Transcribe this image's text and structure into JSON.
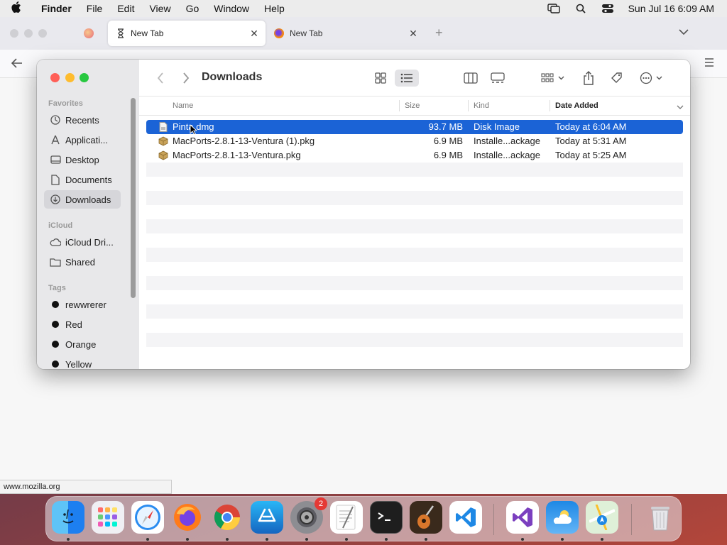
{
  "menubar": {
    "app": "Finder",
    "items": [
      "File",
      "Edit",
      "View",
      "Go",
      "Window",
      "Help"
    ],
    "datetime": "Sun Jul 16  6:09 AM"
  },
  "browser": {
    "tabs": [
      {
        "label": "New Tab",
        "active": true
      },
      {
        "label": "New Tab",
        "active": false
      }
    ],
    "status_url": "www.mozilla.org"
  },
  "finder": {
    "title": "Downloads",
    "sidebar": {
      "favorites_header": "Favorites",
      "favorites": [
        {
          "label": "Recents",
          "icon": "clock-icon"
        },
        {
          "label": "Applicati...",
          "icon": "applications-icon"
        },
        {
          "label": "Desktop",
          "icon": "desktop-icon"
        },
        {
          "label": "Documents",
          "icon": "document-icon"
        },
        {
          "label": "Downloads",
          "icon": "download-icon",
          "selected": true
        }
      ],
      "icloud_header": "iCloud",
      "icloud": [
        {
          "label": "iCloud Dri...",
          "icon": "cloud-icon"
        },
        {
          "label": "Shared",
          "icon": "shared-folder-icon"
        }
      ],
      "tags_header": "Tags",
      "tags": [
        {
          "label": "rewwrerer"
        },
        {
          "label": "Red"
        },
        {
          "label": "Orange"
        },
        {
          "label": "Yellow"
        }
      ]
    },
    "columns": {
      "name": "Name",
      "size": "Size",
      "kind": "Kind",
      "date": "Date Added"
    },
    "files": [
      {
        "name": "Pinta.dmg",
        "size": "93.7 MB",
        "kind": "Disk Image",
        "date": "Today at 6:04 AM",
        "icon": "dmg-file-icon",
        "selected": true
      },
      {
        "name": "MacPorts-2.8.1-13-Ventura (1).pkg",
        "size": "6.9 MB",
        "kind": "Installe...ackage",
        "date": "Today at 5:31 AM",
        "icon": "package-icon"
      },
      {
        "name": "MacPorts-2.8.1-13-Ventura.pkg",
        "size": "6.9 MB",
        "kind": "Installe...ackage",
        "date": "Today at 5:25 AM",
        "icon": "package-icon"
      }
    ]
  },
  "dock": {
    "apps": [
      "finder-icon",
      "launchpad-icon",
      "safari-icon",
      "firefox-icon",
      "chrome-icon",
      "app-store-icon",
      "system-settings-icon",
      "textedit-icon",
      "terminal-icon",
      "garageband-icon",
      "vscode-icon",
      "visual-studio-icon",
      "weather-icon",
      "maps-icon",
      "trash-icon"
    ],
    "settings_badge": "2"
  },
  "colors": {
    "selection": "#1b63d6",
    "close": "#ff5f57",
    "minimize": "#febc2e",
    "zoom": "#28c840"
  }
}
